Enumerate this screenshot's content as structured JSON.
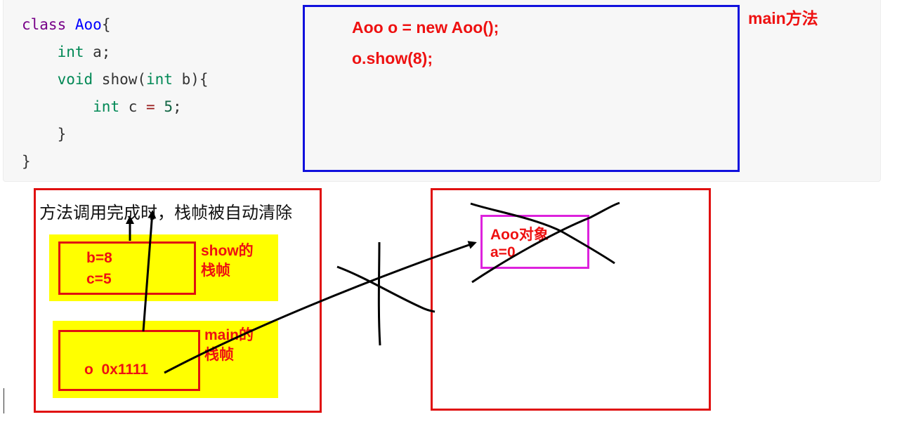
{
  "code": {
    "lines": [
      {
        "k1": "class",
        "name": "Aoo",
        "tail": "{"
      },
      {
        "indent": "    ",
        "type": "int",
        "rest": " a;"
      },
      {
        "indent": "    ",
        "type": "void",
        "mid": " show(",
        "type2": "int",
        "rest": " b){"
      },
      {
        "indent": "        ",
        "type": "int",
        "mid": " c ",
        "op": "=",
        "sp": " ",
        "num": "5",
        "rest": ";"
      },
      {
        "text": "    }"
      },
      {
        "text": "}"
      }
    ]
  },
  "main_box": {
    "stmt1": "Aoo o = new Aoo();",
    "stmt2": "o.show(8);",
    "label": "main方法"
  },
  "stack": {
    "caption": "方法调用完成时，栈帧被自动清除",
    "show_frame": {
      "line1": "b=8",
      "line2": "c=5",
      "label1": "show的",
      "label2": "栈帧"
    },
    "main_frame": {
      "value": "o  0x1111",
      "label1": "main的",
      "label2": "栈帧"
    }
  },
  "heap": {
    "object": {
      "line1": "Aoo对象",
      "line2": "a=0"
    }
  },
  "colors": {
    "red": "#ee1111",
    "blue": "#1010dd",
    "yellow": "#ffff00",
    "magenta": "#dd22dd"
  }
}
